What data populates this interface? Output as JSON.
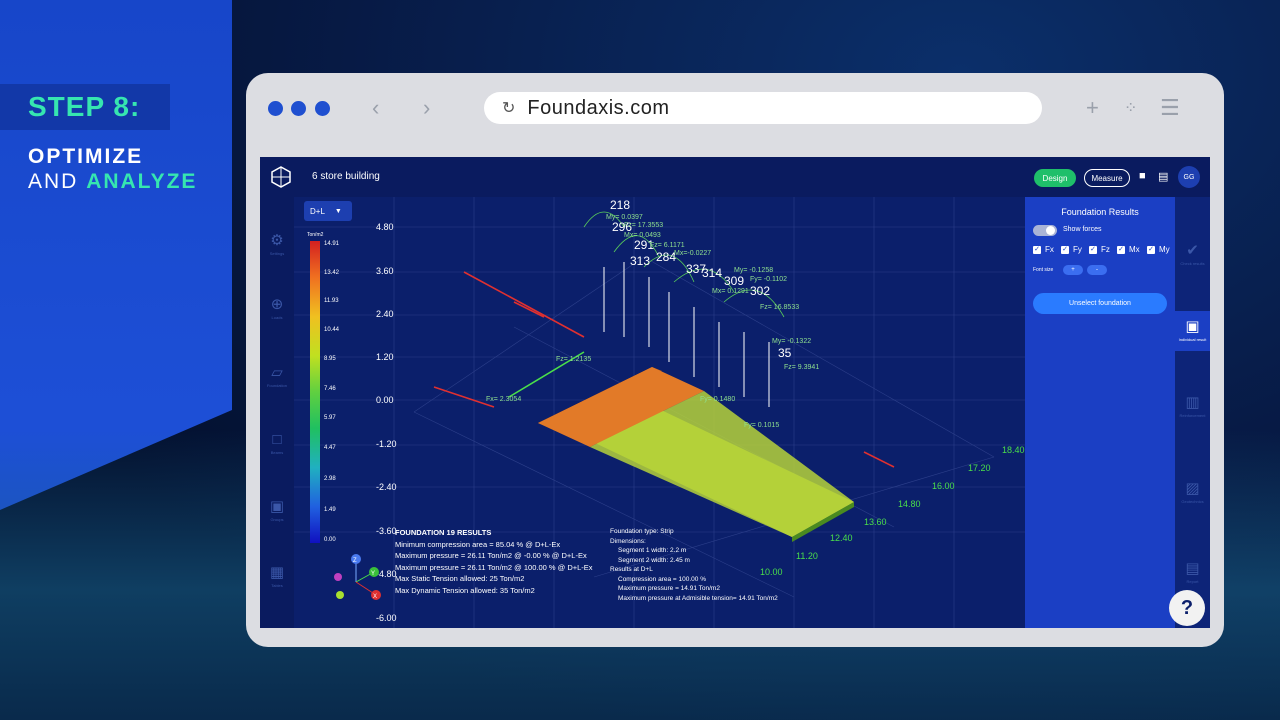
{
  "promo": {
    "step": "STEP 8:",
    "line1": "OPTIMIZE",
    "line2_prefix": "AND",
    "line2_accent": "ANALYZE"
  },
  "browser": {
    "url": "Foundaxis.com",
    "icons": [
      "back-arrow-icon",
      "forward-arrow-icon",
      "reload-icon",
      "plus-icon",
      "grid-icon",
      "menu-icon"
    ]
  },
  "app": {
    "project_name": "6 store building",
    "design_label": "Design",
    "measure_label": "Measure",
    "avatar": "GG",
    "colors": {
      "design_pill": "#1fbf6a",
      "panel": "#1b3fc4",
      "background": "#0b1f6b"
    }
  },
  "left_rail": [
    {
      "icon": "gear-icon",
      "label": "Settings"
    },
    {
      "icon": "loads-icon",
      "label": "Loads"
    },
    {
      "icon": "foundation-icon",
      "label": "Foundation"
    },
    {
      "icon": "beams-icon",
      "label": "Beams"
    },
    {
      "icon": "groups-icon",
      "label": "Groups"
    },
    {
      "icon": "table-icon",
      "label": "Tables"
    }
  ],
  "viewport": {
    "combo": "D+L",
    "scale": {
      "unit": "Ton/m2",
      "values": [
        "14.91",
        "13.42",
        "11.93",
        "10.44",
        "8.95",
        "7.46",
        "5.97",
        "4.47",
        "2.98",
        "1.49",
        "0.00"
      ]
    },
    "z_axis": [
      "4.80",
      "3.60",
      "2.40",
      "1.20",
      "0.00",
      "-1.20",
      "-2.40",
      "-3.60",
      "-4.80",
      "-6.00"
    ],
    "y_axis": [
      "10.00",
      "11.20",
      "12.40",
      "13.60",
      "14.80",
      "16.00",
      "17.20",
      "18.40"
    ],
    "node_ids": [
      "218",
      "296",
      "291",
      "313",
      "284",
      "337",
      "314",
      "309",
      "302",
      "35"
    ],
    "force_labels": [
      "My= 0.0397",
      "Fz= 17.3553",
      "Mx= 0.0493",
      "Fz= 6.1171",
      "Mx=-0.0227",
      "My= -0.1258",
      "Mx= 0.1291",
      "Fy= -0.1102",
      "Fz= 16.8533",
      "My= -0.1322",
      "Fz= 9.3941",
      "Fz= 1.2135",
      "Fx= 2.3054",
      "Fy= 0.1480",
      "Fy= 0.1015"
    ],
    "results_main": {
      "title": "FOUNDATION 19 RESULTS",
      "lines": [
        "Minimum compression area = 85.04 % @ D+L-Ex",
        "Maximum pressure = 26.11 Ton/m2 @ -0.00 % @ D+L-Ex",
        "Maximum pressure = 26.11 Ton/m2 @ 100.00 % @ D+L-Ex",
        "Max Static Tension allowed: 25 Ton/m2",
        "Max Dynamic Tension allowed: 35 Ton/m2"
      ]
    },
    "results_secondary": {
      "lines": [
        "Foundation type: Strip",
        "Dimensions:",
        "Segment 1 width: 2.2 m",
        "Segment 2 width: 2.45 m",
        "",
        "Results at D+L",
        "Compression area = 100.00 %",
        "Maximum pressure = 14.91 Ton/m2",
        "Maximum pressure at Admisible tension= 14.91 Ton/m2"
      ]
    },
    "gizmo_labels": [
      "Z",
      "Y",
      "X"
    ]
  },
  "panel": {
    "title": "Foundation Results",
    "show_forces": "Show forces",
    "checkboxes": [
      "Fx",
      "Fy",
      "Fz",
      "Mx",
      "My"
    ],
    "font_size_label": "Font size",
    "unselect": "Unselect foundation"
  },
  "far_rail": [
    {
      "icon": "check-icon",
      "label": "Check results"
    },
    {
      "icon": "cube-icon",
      "label": "Individual result"
    },
    {
      "icon": "reinforcement-icon",
      "label": "Reinforcement"
    },
    {
      "icon": "geotechnics-icon",
      "label": "Geotechnics"
    },
    {
      "icon": "report-icon",
      "label": "Report"
    }
  ],
  "help": "?"
}
